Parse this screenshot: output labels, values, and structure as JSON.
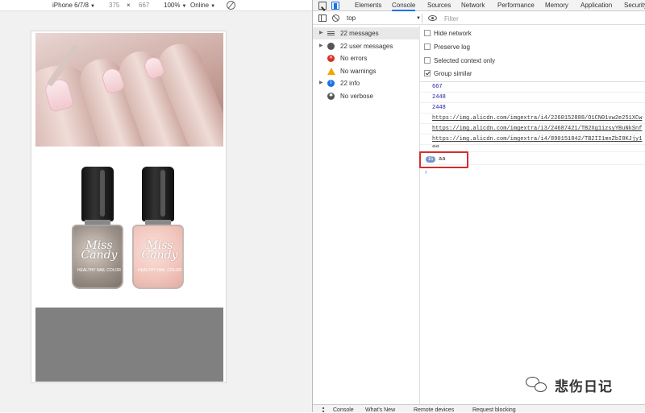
{
  "device_toolbar": {
    "device": "iPhone 6/7/8",
    "width": "375",
    "separator": "×",
    "height": "667",
    "zoom": "100%",
    "network": "Online"
  },
  "devtools": {
    "tabs": [
      "Elements",
      "Console",
      "Sources",
      "Network",
      "Performance",
      "Memory",
      "Application",
      "Security"
    ],
    "active_tab": "Console"
  },
  "console_toolbar": {
    "context": "top",
    "filter_placeholder": "Filter"
  },
  "sidebar": {
    "items": [
      {
        "label": "22 messages",
        "icon": "list-icon"
      },
      {
        "label": "22 user messages",
        "icon": "user-icon"
      },
      {
        "label": "No errors",
        "icon": "error-icon"
      },
      {
        "label": "No warnings",
        "icon": "warning-icon"
      },
      {
        "label": "22 info",
        "icon": "info-icon"
      },
      {
        "label": "No verbose",
        "icon": "verbose-icon"
      }
    ]
  },
  "settings": [
    {
      "label": "Hide network",
      "checked": false
    },
    {
      "label": "Preserve log",
      "checked": false
    },
    {
      "label": "Selected context only",
      "checked": false
    },
    {
      "label": "Group similar",
      "checked": true
    }
  ],
  "logs": [
    {
      "text": "667",
      "kind": "num"
    },
    {
      "text": "2448",
      "kind": "num"
    },
    {
      "text": "2448",
      "kind": "num"
    },
    {
      "text": "https://img.alicdn.com/imgextra/i4/2260152888/O1CN01vw2e251XCw",
      "kind": "url"
    },
    {
      "text": "https://img.alicdn.com/imgextra/i3/24687421/TB2Xg1izsyYBuNkSnf",
      "kind": "url"
    },
    {
      "text": "https://img.alicdn.com/imgextra/i4/890151842/TB2II1mnZbI8KJjy1",
      "kind": "url"
    },
    {
      "text": "aa",
      "kind": "plain"
    },
    {
      "text": "aa",
      "kind": "plain",
      "repeat": "15"
    }
  ],
  "bottles": [
    {
      "brand": "Miss Candy",
      "sub": "HEALTHY NAIL COLOR"
    },
    {
      "brand": "Miss Candy",
      "sub": "HEALTHY NAIL COLOR"
    }
  ],
  "drawer": {
    "tabs": [
      "Console",
      "What's New",
      "Remote devices",
      "Request blocking"
    ]
  },
  "watermark": {
    "text": "悲伤日记"
  },
  "colors": {
    "accent": "#1a73e8",
    "highlight": "#d32f2f",
    "gray_block": "#808080"
  }
}
